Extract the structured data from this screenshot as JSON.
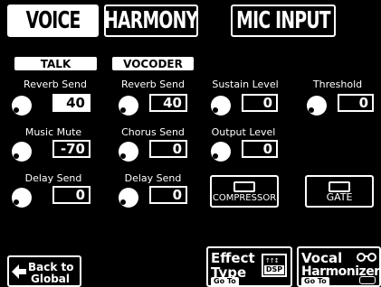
{
  "tabs": [
    {
      "label": "VOICE",
      "active": true
    },
    {
      "label": "HARMONY",
      "active": false
    },
    {
      "label": "MIC INPUT",
      "active": false
    }
  ],
  "modes": {
    "talk": "TALK",
    "vocoder": "VOCODER"
  },
  "talk": {
    "reverb_send": {
      "label": "Reverb Send",
      "value": "40"
    },
    "music_mute": {
      "label": "Music Mute",
      "value": "-70"
    },
    "delay_send": {
      "label": "Delay Send",
      "value": "0"
    }
  },
  "vocoder": {
    "reverb_send": {
      "label": "Reverb Send",
      "value": "40"
    },
    "chorus_send": {
      "label": "Chorus Send",
      "value": "0"
    },
    "delay_send": {
      "label": "Delay Send",
      "value": "0"
    }
  },
  "sustain_level": {
    "label": "Sustain Level",
    "value": "0"
  },
  "threshold": {
    "label": "Threshold",
    "value": "0"
  },
  "output_level": {
    "label": "Output Level",
    "value": "0"
  },
  "compressor": {
    "label": "COMPRESSOR"
  },
  "gate": {
    "label": "GATE"
  },
  "nav": {
    "back_line1": "Back to",
    "back_line2": "Global",
    "effect_line1": "Effect",
    "effect_line2": "Type",
    "effect_goto": "Go To",
    "effect_icon_text": "DSP",
    "harm_line1": "Vocal",
    "harm_line2": "Harmonizer",
    "harm_goto": "Go To"
  },
  "colors": {
    "background": "#000000",
    "foreground": "#ffffff"
  }
}
